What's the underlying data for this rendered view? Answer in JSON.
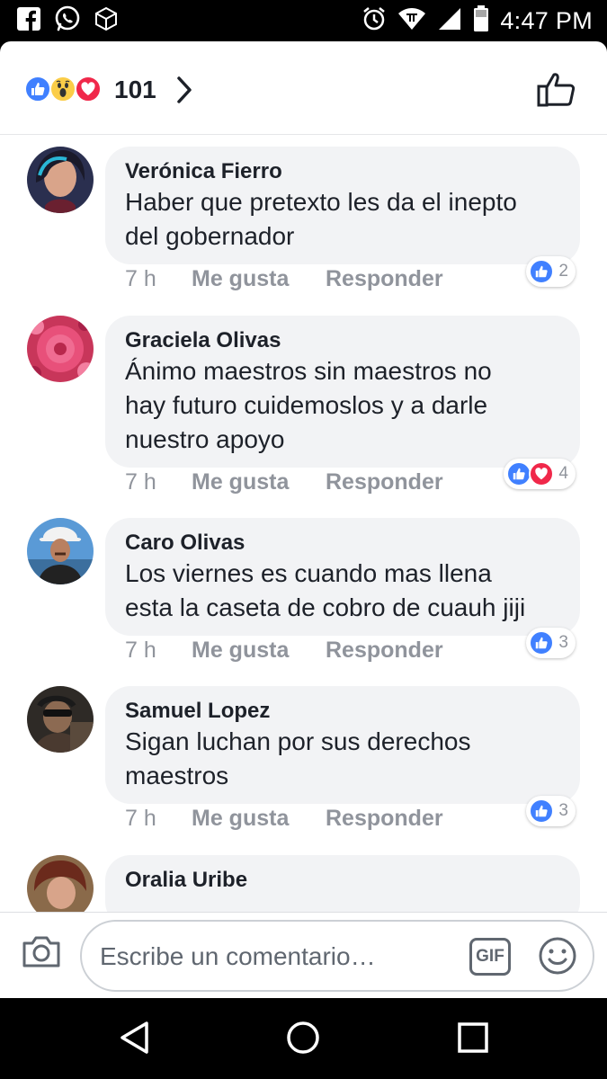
{
  "status_bar": {
    "time": "4:47 PM",
    "left_icons": [
      "facebook-icon",
      "whatsapp-icon",
      "cube-icon"
    ],
    "right_icons": [
      "alarm-icon",
      "wifi-icon",
      "signal-icon",
      "battery-icon"
    ]
  },
  "reactions_header": {
    "reaction_icons": [
      "like",
      "wow",
      "love"
    ],
    "count": "101",
    "chevron_icon": "chevron-right-icon",
    "like_icon": "thumbs-up-outline-icon"
  },
  "comments": [
    {
      "name": "Verónica Fierro",
      "lines": [
        "Haber que pretexto les da el inepto",
        "del gobernador"
      ],
      "time": "7 h",
      "like_label": "Me gusta",
      "reply_label": "Responder",
      "reactions": [
        "like"
      ],
      "reaction_count": "2"
    },
    {
      "name": "Graciela Olivas",
      "lines": [
        "Ánimo  maestros sin maestros no",
        "hay  futuro cuidemoslos y a darle",
        "nuestro apoyo"
      ],
      "time": "7 h",
      "like_label": "Me gusta",
      "reply_label": "Responder",
      "reactions": [
        "like",
        "love"
      ],
      "reaction_count": "4"
    },
    {
      "name": "Caro Olivas",
      "lines": [
        "Los viernes es cuando mas llena",
        "esta la caseta de cobro de cuauh jiji"
      ],
      "time": "7 h",
      "like_label": "Me gusta",
      "reply_label": "Responder",
      "reactions": [
        "like"
      ],
      "reaction_count": "3"
    },
    {
      "name": "Samuel Lopez",
      "lines": [
        "Sigan luchan por sus derechos",
        "maestros"
      ],
      "time": "7 h",
      "like_label": "Me gusta",
      "reply_label": "Responder",
      "reactions": [
        "like"
      ],
      "reaction_count": "3"
    },
    {
      "name": "Oralia Uribe",
      "lines": [],
      "time": "",
      "like_label": "",
      "reply_label": "",
      "reactions": [],
      "reaction_count": ""
    }
  ],
  "composer": {
    "placeholder": "Escribe un comentario…",
    "gif_label": "GIF",
    "camera_icon": "camera-icon",
    "emoji_icon": "emoji-icon"
  },
  "colors": {
    "like_blue": "#4080ff",
    "love_red": "#f0284a",
    "wow_yellow": "#fbcd48",
    "text_dark": "#1d2129",
    "text_gray": "#90949c",
    "bubble_bg": "#f2f3f5"
  },
  "nav_bar": [
    "back-icon",
    "home-icon",
    "recents-icon"
  ]
}
